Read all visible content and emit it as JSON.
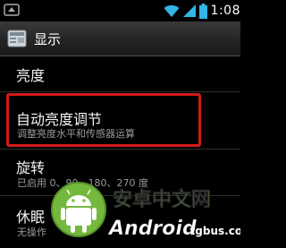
{
  "status_bar": {
    "time": "1:08",
    "left_icon": "notification-icon",
    "wifi_icon": "wifi-icon",
    "signal_icon": "signal-icon",
    "battery_icon": "battery-icon"
  },
  "header": {
    "icon": "display-settings-icon",
    "title": "显示"
  },
  "settings": [
    {
      "title": "亮度",
      "summary": ""
    },
    {
      "title": "自动亮度调节",
      "summary": "调整亮度水平和传感器运算"
    },
    {
      "title": "旋转",
      "summary": "已启用 0、90、180、270 度"
    },
    {
      "title": "休眠",
      "summary": "无操作"
    }
  ],
  "watermark": {
    "line1": "安卓中文网",
    "line2": "Android",
    "line3": ".tgbus.com"
  },
  "colors": {
    "highlight": "#d11a1a",
    "watermark_green": "#7cc242",
    "status_icon_blue": "#33b5e5"
  }
}
